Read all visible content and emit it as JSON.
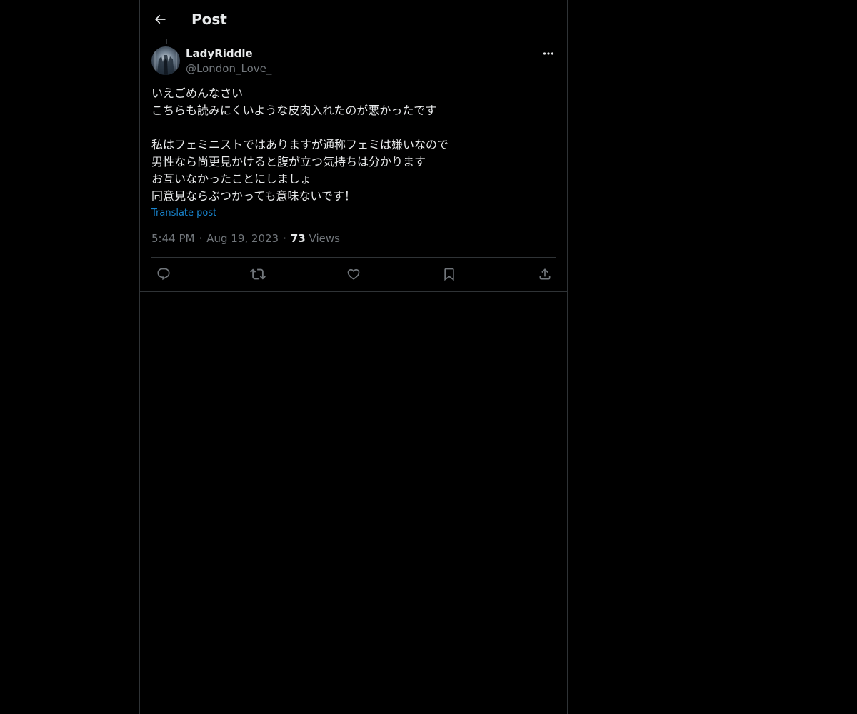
{
  "header": {
    "title": "Post",
    "back_icon": "arrow-left-icon"
  },
  "author": {
    "display_name": "LadyRiddle",
    "handle": "@London_Love_",
    "more_icon": "more-horizontal-icon"
  },
  "post": {
    "lines": [
      "いえごめんなさい",
      "こちらも読みにくいような皮肉入れたのが悪かったです",
      "",
      "私はフェミニストではありますが通称フェミは嫌いなので",
      "男性なら尚更見かけると腹が立つ気持ちは分かります",
      "お互いなかったことにしましょ",
      "同意見ならぶつかっても意味ないです！"
    ],
    "translate_label": "Translate post"
  },
  "meta": {
    "time": "5:44 PM",
    "date": "Aug 19, 2023",
    "views_count": "73",
    "views_label": "Views",
    "separator": "·"
  },
  "actions": [
    {
      "name": "reply",
      "icon": "reply-icon"
    },
    {
      "name": "repost",
      "icon": "repost-icon"
    },
    {
      "name": "like",
      "icon": "heart-icon"
    },
    {
      "name": "bookmark",
      "icon": "bookmark-icon"
    },
    {
      "name": "share",
      "icon": "share-icon"
    }
  ],
  "colors": {
    "background": "#000000",
    "text_primary": "#e7e9ea",
    "text_secondary": "#71767b",
    "accent": "#1d9bf0",
    "border": "#2f3336"
  }
}
